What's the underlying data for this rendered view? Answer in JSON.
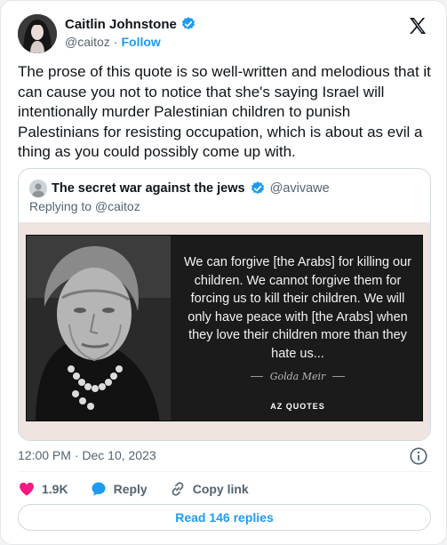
{
  "author": {
    "name": "Caitlin Johnstone",
    "handle": "@caitoz",
    "separator": "·",
    "follow_label": "Follow"
  },
  "tweet_text": "The prose of this quote is so well-written and melodious that it can cause you not to notice that she's saying Israel will intentionally murder Palestinian children to punish Palestinians for resisting occupation, which is about as evil a thing as you could possibly come up with.",
  "quoted": {
    "name": "The secret war against the jews",
    "handle": "@avivawe",
    "replying_to": "Replying to @caitoz",
    "image": {
      "quote": "We can forgive [the Arabs] for killing our children. We cannot forgive them for forcing us to kill their children. We will only have peace with [the Arabs] when they love their children more than they hate us...",
      "attribution": "Golda Meir",
      "brand": "AZ QUOTES"
    }
  },
  "timestamp": "12:00 PM · Dec 10, 2023",
  "actions": {
    "like_count": "1.9K",
    "reply_label": "Reply",
    "copy_label": "Copy link"
  },
  "read_replies_label": "Read 146 replies",
  "icons": {
    "like": "heart-icon",
    "reply": "speech-bubble-icon",
    "copy": "link-icon",
    "info": "info-icon",
    "verified": "verified-badge-icon",
    "platform": "x-logo-icon"
  },
  "colors": {
    "accent": "#1d9bf0",
    "like": "#f91880",
    "text": "#0f1419",
    "secondary": "#536471"
  }
}
